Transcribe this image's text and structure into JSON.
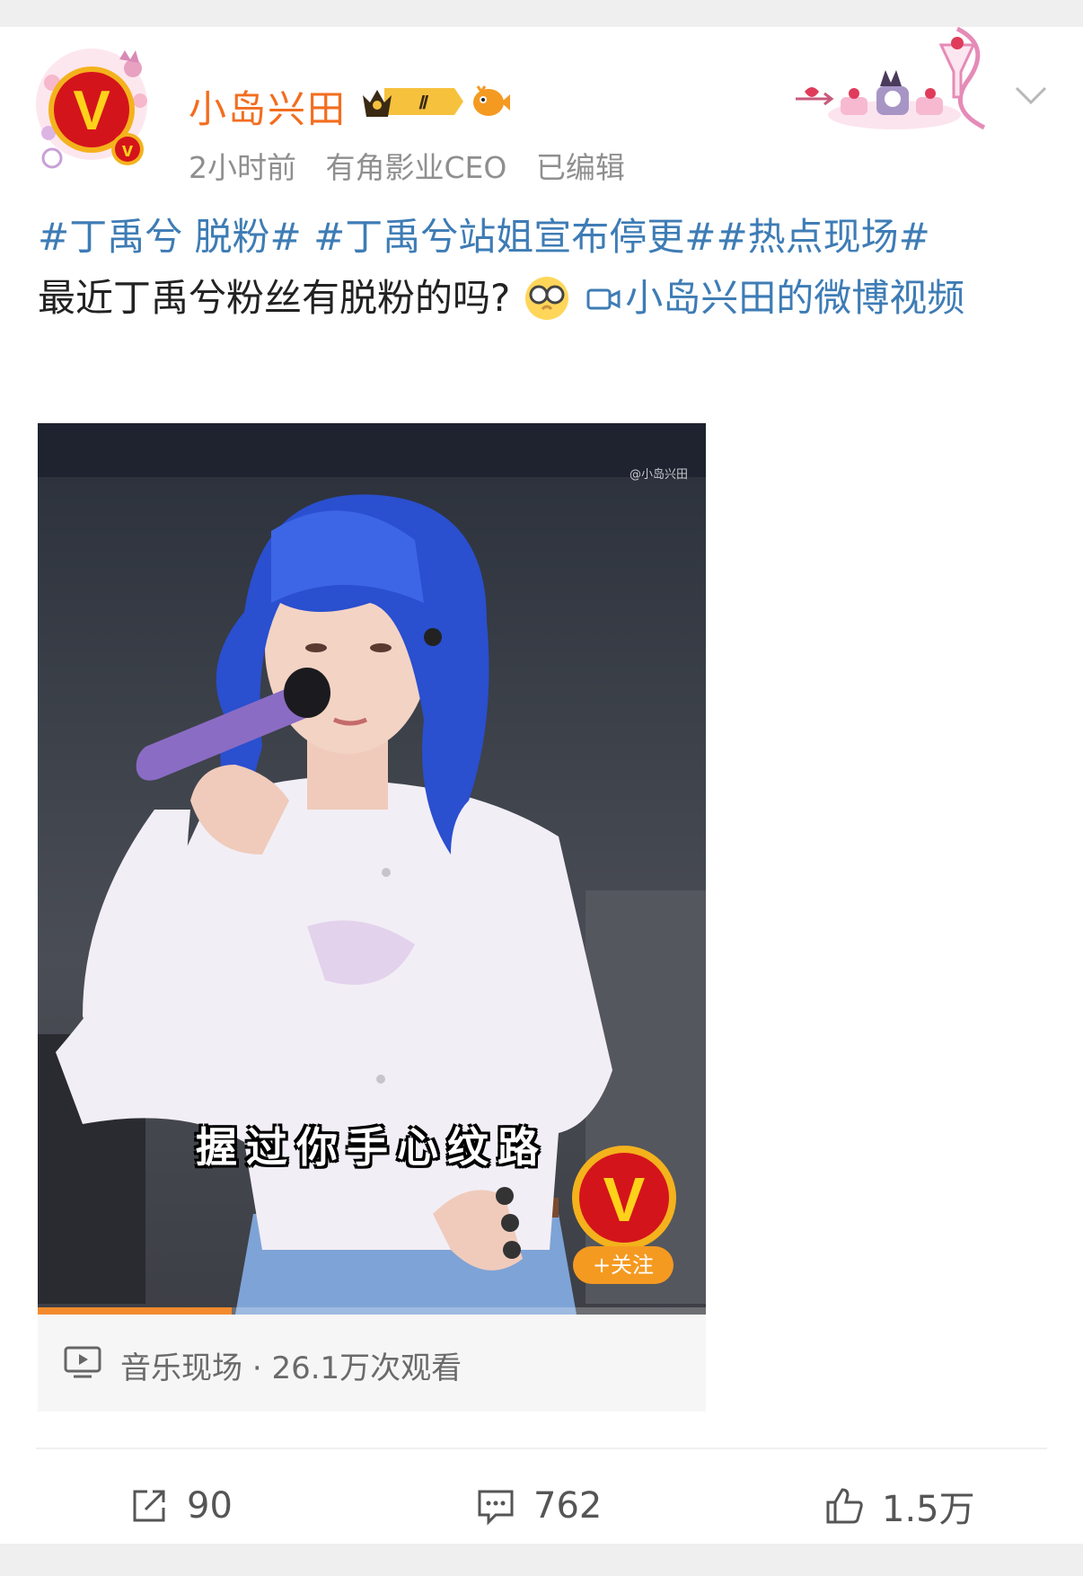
{
  "post": {
    "author": {
      "name": "小岛兴田",
      "level_badge": "Ⅱ",
      "avatar_letter": "V",
      "verified_letter": "v"
    },
    "meta": {
      "time": "2小时前",
      "source": "有角影业CEO",
      "edited": "已编辑"
    },
    "text": {
      "topic1": "#丁禹兮 脱粉#",
      "topic2": "#丁禹兮站姐宣布停更#",
      "topic3": "#热点现场#",
      "body": "最近丁禹兮粉丝有脱粉的吗?",
      "video_link": "小岛兴田的微博视频"
    },
    "video": {
      "watermark": "@小岛兴田",
      "subtitle": "握过你手心纹路",
      "follow_label": "+关注",
      "badge_letter": "V",
      "progress": 0.29,
      "category": "音乐现场",
      "separator": "·",
      "views": "26.1万次观看"
    },
    "actions": {
      "repost_count": "90",
      "comment_count": "762",
      "like_count": "1.5万"
    }
  },
  "icons": {
    "more": "chevron-down-icon",
    "repost": "repost-icon",
    "comment": "comment-icon",
    "like": "thumbs-up-icon",
    "play": "video-play-icon"
  },
  "colors": {
    "username": "#f36d1f",
    "link": "#3e7cb5",
    "progress": "#f38a2e",
    "follow": "#f59a21"
  }
}
